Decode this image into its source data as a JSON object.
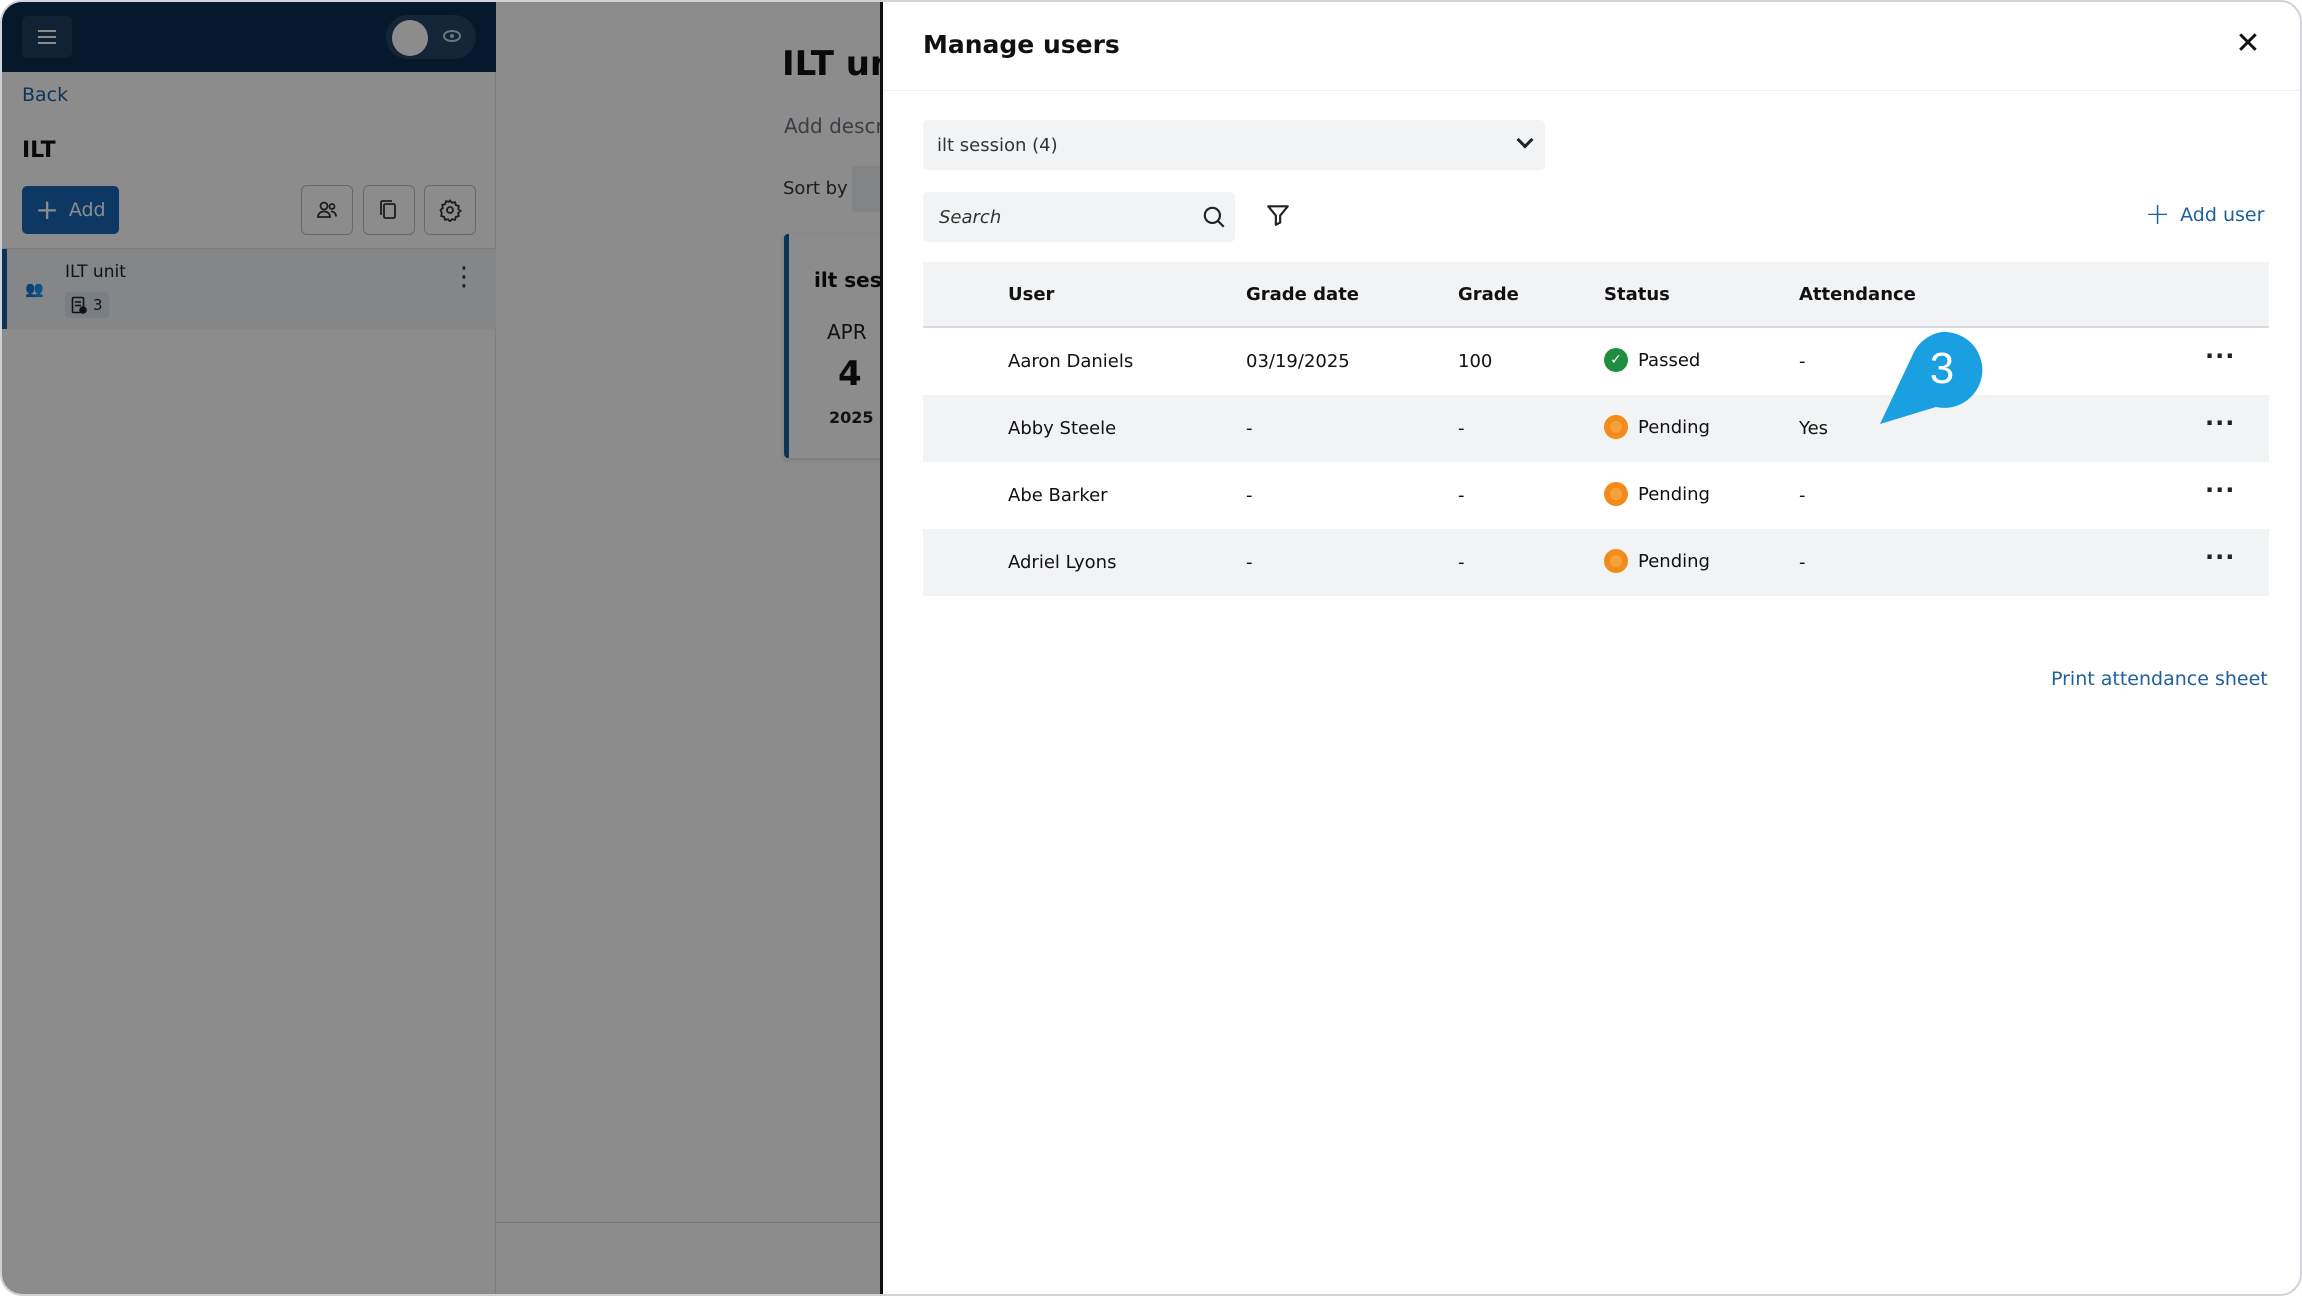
{
  "background": {
    "back_label": "Back",
    "course_title": "ILT",
    "add_label": "Add",
    "unit": {
      "name": "ILT unit",
      "badge_count": "3"
    },
    "heading": "ILT un",
    "add_description": "Add descr",
    "sort_by": "Sort by",
    "session_card": {
      "title": "ilt sess",
      "month": "APR",
      "day": "4",
      "year": "2025"
    }
  },
  "modal": {
    "title": "Manage users",
    "session_select": "ilt session (4)",
    "search_placeholder": "Search",
    "add_user_label": "Add user",
    "print_label": "Print attendance sheet",
    "columns": [
      "User",
      "Grade date",
      "Grade",
      "Status",
      "Attendance"
    ],
    "rows": [
      {
        "user": "Aaron Daniels",
        "grade_date": "03/19/2025",
        "grade": "100",
        "status": "Passed",
        "attendance": "-"
      },
      {
        "user": "Abby Steele",
        "grade_date": "-",
        "grade": "-",
        "status": "Pending",
        "attendance": "Yes"
      },
      {
        "user": "Abe Barker",
        "grade_date": "-",
        "grade": "-",
        "status": "Pending",
        "attendance": "-"
      },
      {
        "user": "Adriel Lyons",
        "grade_date": "-",
        "grade": "-",
        "status": "Pending",
        "attendance": "-"
      }
    ]
  },
  "callout": {
    "number": "3",
    "color": "#1a9fe0"
  },
  "colors": {
    "brand_dark": "#0c2c4f",
    "primary": "#1766b4",
    "link": "#1d5f9f",
    "passed": "#1e8e3e",
    "pending": "#f28b1c"
  }
}
